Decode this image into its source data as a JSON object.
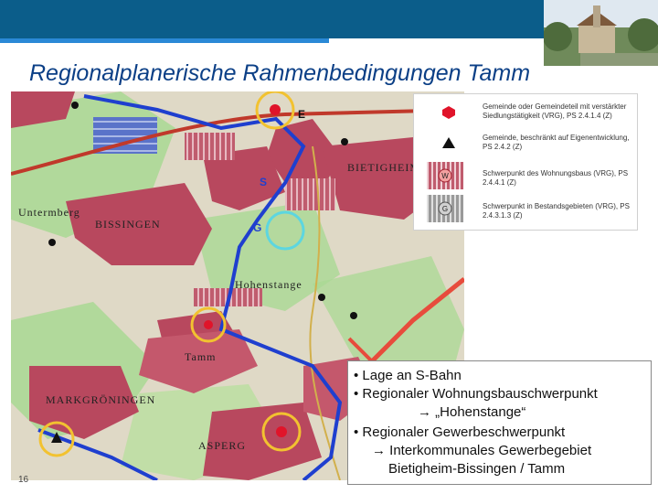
{
  "slide": {
    "title": "Regionalplanerische Rahmenbedingungen Tamm",
    "number": "16"
  },
  "map": {
    "places": {
      "bietigheim": "BIETIGHEIM",
      "bissingen": "BISSINGEN",
      "untermberg": "Untermberg",
      "hohenstange": "Hohenstange",
      "tamm": "Tamm",
      "markgroeningen": "MARKGRÖNINGEN",
      "asperg": "ASPERG"
    },
    "labels": {
      "s_bahn_mark": "S",
      "gewerbe_mark": "G",
      "railway_mark": "E"
    }
  },
  "legend": {
    "items": [
      {
        "text": "Gemeinde oder Gemeindeteil mit verstärkter Siedlungstätigkeit (VRG), PS 2.4.1.4 (Z)",
        "symbol": "red-hexagon"
      },
      {
        "text": "Gemeinde, beschränkt auf Eigenentwicklung, PS 2.4.2 (Z)",
        "symbol": "black-triangle"
      },
      {
        "text": "Schwerpunkt des Wohnungsbaus (VRG), PS 2.4.4.1 (Z)",
        "symbol": "W"
      },
      {
        "text": "Schwerpunkt in Bestandsgebieten (VRG), PS 2.4.3.1.3 (Z)",
        "symbol": "G"
      }
    ]
  },
  "bullets": {
    "b1": "• Lage an S-Bahn",
    "b2": "• Regionaler Wohnungsbauschwerpunkt",
    "b3": "→ „Hohenstange“",
    "b4": "• Regionaler Gewerbeschwerpunkt",
    "b5": "→ Interkommunales Gewerbegebiet",
    "b6": "Bietigheim-Bissingen / Tamm"
  },
  "colors": {
    "header": "#0b5d8a",
    "title": "#0b3f86",
    "settlement": "#b8485e",
    "green_zone": "#9fd48a",
    "s_bahn": "#1f3fcf",
    "circle_yellow": "#f2c230",
    "circle_cyan": "#5cd6e0"
  }
}
